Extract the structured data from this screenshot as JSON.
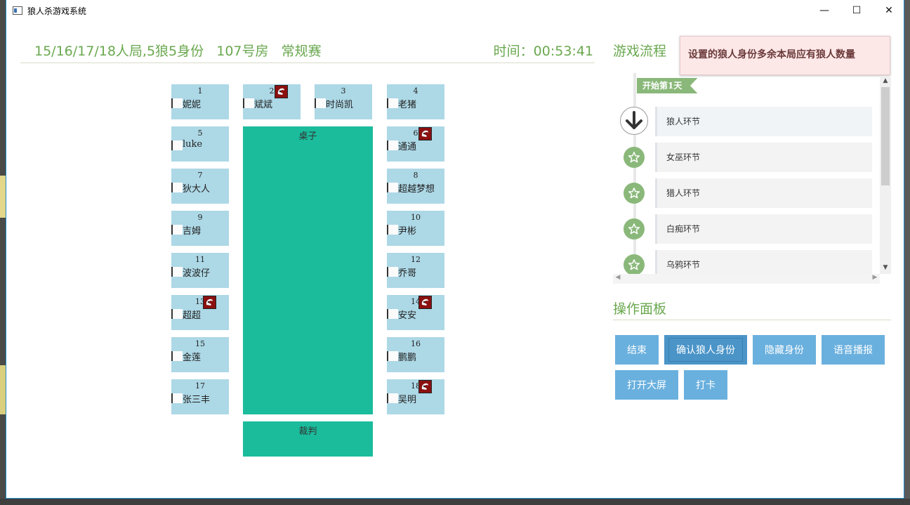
{
  "window": {
    "title": "狼人杀游戏系统",
    "controls": {
      "minimize": "—",
      "maximize": "☐",
      "close": "✕"
    }
  },
  "header": {
    "info": "15/16/17/18人局,5狼5身份   107号房   常规赛",
    "time": "时间：00:53:41"
  },
  "seats": [
    {
      "num": "1",
      "name": "妮妮"
    },
    {
      "num": "2",
      "name": "斌斌",
      "wolf": true
    },
    {
      "num": "3",
      "name": "时尚凯"
    },
    {
      "num": "4",
      "name": "老猪"
    },
    {
      "num": "5",
      "name": "luke"
    },
    {
      "num": "6",
      "name": "通通",
      "wolf": true
    },
    {
      "num": "7",
      "name": "狄大人"
    },
    {
      "num": "8",
      "name": "超越梦想"
    },
    {
      "num": "9",
      "name": "吉姆"
    },
    {
      "num": "10",
      "name": "尹彬"
    },
    {
      "num": "11",
      "name": "波波仔"
    },
    {
      "num": "12",
      "name": "乔哥"
    },
    {
      "num": "13",
      "name": "超超",
      "wolf": true
    },
    {
      "num": "14",
      "name": "安安",
      "wolf": true
    },
    {
      "num": "15",
      "name": "金莲"
    },
    {
      "num": "16",
      "name": "鹏鹏"
    },
    {
      "num": "17",
      "name": "张三丰"
    },
    {
      "num": "18",
      "name": "吴明",
      "wolf": true
    }
  ],
  "table_label": "桌子",
  "judge_label": "裁判",
  "flow": {
    "title": "游戏流程",
    "day_tag": "开始第1天",
    "items": [
      "狼人环节",
      "女巫环节",
      "猎人环节",
      "白痴环节",
      "乌鸦环节"
    ]
  },
  "panel": {
    "title": "操作面板",
    "buttons": [
      "结束",
      "确认狼人身份",
      "隐藏身份",
      "语音播报",
      "打开大屏",
      "打卡"
    ]
  },
  "toast": "设置的狼人身份多余本局应有狼人数量",
  "colors": {
    "accent_green": "#6aa84f",
    "seat_blue": "#add8e6",
    "table_teal": "#1abc9c",
    "button_blue": "#6ab0de",
    "wolf_red": "#8b1010"
  }
}
